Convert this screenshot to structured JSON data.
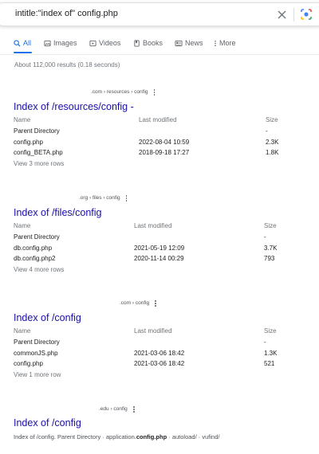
{
  "search": {
    "query": "intitle:\"index of\" config.php"
  },
  "tabs": [
    {
      "label": "All",
      "icon": "search-icon"
    },
    {
      "label": "Images",
      "icon": "image-icon"
    },
    {
      "label": "Videos",
      "icon": "video-icon"
    },
    {
      "label": "Books",
      "icon": "book-icon"
    },
    {
      "label": "News",
      "icon": "news-icon"
    },
    {
      "label": "More",
      "icon": "more-vert-icon"
    }
  ],
  "stats": "About 112,000 results (0.18 seconds)",
  "results": [
    {
      "site": ".com › resources › config",
      "title": "Index of /resources/config",
      "title_suffix": "-",
      "headers": [
        "Name",
        "Last modified",
        "Size"
      ],
      "rows": [
        [
          "Parent Directory",
          "",
          "-"
        ],
        [
          "config.php",
          "2022-08-04 10:59",
          "2.3K"
        ],
        [
          "config_BETA.php",
          "2018-09-18 17:27",
          "1.8K"
        ]
      ],
      "more": "View 3 more rows"
    },
    {
      "site": ".org › files › config",
      "title": "Index of /files/config",
      "title_suffix": "",
      "headers": [
        "Name",
        "Last modified",
        "Size"
      ],
      "rows": [
        [
          "Parent Directory",
          "",
          "-"
        ],
        [
          "db.config.php",
          "2021-05-19 12:09",
          "3.7K"
        ],
        [
          "db.config.php2",
          "2020-11-14 00:29",
          "793"
        ]
      ],
      "more": "View 4 more rows"
    },
    {
      "site": ".com › config",
      "title": "Index of /config",
      "title_suffix": "",
      "headers": [
        "Name",
        "Last modified",
        "Size"
      ],
      "rows": [
        [
          "Parent Directory",
          "",
          "-"
        ],
        [
          "commonJS.php",
          "2021-03-06 18:42",
          "1.3K"
        ],
        [
          "config.php",
          "2021-03-06 18:42",
          "521"
        ]
      ],
      "more": "View 1 more row"
    },
    {
      "site": ".edu › config",
      "title": "Index of /config",
      "snippet_pre": "Index of /config. Parent Directory · application.",
      "snippet_bold": "config.php",
      "snippet_post": " · autoload/ · vufind/"
    }
  ],
  "colors": {
    "link": "#1a0dab",
    "accent": "#1a73e8",
    "muted": "#70757a"
  }
}
